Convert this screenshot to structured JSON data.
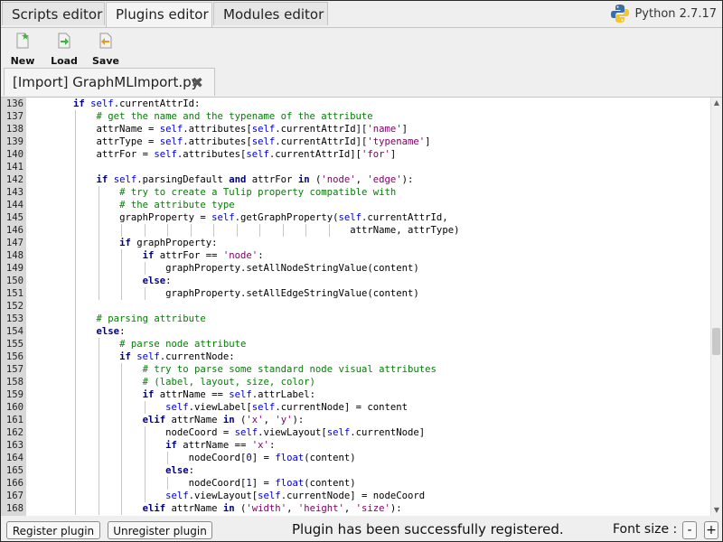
{
  "tabs": [
    {
      "label": "Scripts editor",
      "active": false
    },
    {
      "label": "Plugins editor",
      "active": true
    },
    {
      "label": "Modules editor",
      "active": false
    }
  ],
  "python_version": "Python 2.7.17",
  "toolbar": {
    "new_label": "New",
    "load_label": "Load",
    "save_label": "Save"
  },
  "file_tab": {
    "label": "[Import] GraphMLImport.py",
    "close_glyph": "✖"
  },
  "code_lines": [
    {
      "n": "136",
      "indent": 2,
      "guides": 2,
      "tokens": [
        [
          "kw",
          "if "
        ],
        [
          "sf",
          "self"
        ],
        [
          "",
          "."
        ],
        [
          "",
          "currentAttrId:"
        ]
      ]
    },
    {
      "n": "137",
      "indent": 3,
      "guides": 3,
      "tokens": [
        [
          "cm",
          "# get the name and the typename of the attribute"
        ]
      ]
    },
    {
      "n": "138",
      "indent": 3,
      "guides": 3,
      "tokens": [
        [
          "",
          "attrName = "
        ],
        [
          "sf",
          "self"
        ],
        [
          "",
          ".attributes["
        ],
        [
          "sf",
          "self"
        ],
        [
          "",
          ".currentAttrId]["
        ],
        [
          "st",
          "'name'"
        ],
        [
          "",
          "]"
        ]
      ]
    },
    {
      "n": "139",
      "indent": 3,
      "guides": 3,
      "tokens": [
        [
          "",
          "attrType = "
        ],
        [
          "sf",
          "self"
        ],
        [
          "",
          ".attributes["
        ],
        [
          "sf",
          "self"
        ],
        [
          "",
          ".currentAttrId]["
        ],
        [
          "st",
          "'typename'"
        ],
        [
          "",
          "]"
        ]
      ]
    },
    {
      "n": "140",
      "indent": 3,
      "guides": 3,
      "tokens": [
        [
          "",
          "attrFor = "
        ],
        [
          "sf",
          "self"
        ],
        [
          "",
          ".attributes["
        ],
        [
          "sf",
          "self"
        ],
        [
          "",
          ".currentAttrId]["
        ],
        [
          "st",
          "'for'"
        ],
        [
          "",
          "]"
        ]
      ]
    },
    {
      "n": "141",
      "indent": 0,
      "guides": 3,
      "tokens": []
    },
    {
      "n": "142",
      "indent": 3,
      "guides": 3,
      "tokens": [
        [
          "kw",
          "if "
        ],
        [
          "sf",
          "self"
        ],
        [
          "",
          ".parsingDefault "
        ],
        [
          "kw",
          "and"
        ],
        [
          "",
          " attrFor "
        ],
        [
          "kw",
          "in"
        ],
        [
          "",
          " ("
        ],
        [
          "st",
          "'node'"
        ],
        [
          "",
          ", "
        ],
        [
          "st",
          "'edge'"
        ],
        [
          "",
          "):"
        ]
      ]
    },
    {
      "n": "143",
      "indent": 4,
      "guides": 4,
      "tokens": [
        [
          "cm",
          "# try to create a Tulip property compatible with"
        ]
      ]
    },
    {
      "n": "144",
      "indent": 4,
      "guides": 4,
      "tokens": [
        [
          "cm",
          "# the attribute type"
        ]
      ]
    },
    {
      "n": "145",
      "indent": 4,
      "guides": 4,
      "tokens": [
        [
          "",
          "graphProperty = "
        ],
        [
          "sf",
          "self"
        ],
        [
          "",
          ".getGraphProperty("
        ],
        [
          "sf",
          "self"
        ],
        [
          "",
          ".currentAttrId,"
        ]
      ]
    },
    {
      "n": "146",
      "indent": 14,
      "guides": 14,
      "tokens": [
        [
          "",
          "attrName, attrType)"
        ]
      ]
    },
    {
      "n": "147",
      "indent": 4,
      "guides": 4,
      "tokens": [
        [
          "kw",
          "if "
        ],
        [
          "",
          "graphProperty:"
        ]
      ]
    },
    {
      "n": "148",
      "indent": 5,
      "guides": 5,
      "tokens": [
        [
          "kw",
          "if "
        ],
        [
          "",
          "attrFor == "
        ],
        [
          "st",
          "'node'"
        ],
        [
          "",
          ":"
        ]
      ]
    },
    {
      "n": "149",
      "indent": 6,
      "guides": 6,
      "tokens": [
        [
          "",
          "graphProperty.setAllNodeStringValue(content)"
        ]
      ]
    },
    {
      "n": "150",
      "indent": 5,
      "guides": 5,
      "tokens": [
        [
          "kw",
          "else"
        ],
        [
          "",
          ":"
        ]
      ]
    },
    {
      "n": "151",
      "indent": 6,
      "guides": 6,
      "tokens": [
        [
          "",
          "graphProperty.setAllEdgeStringValue(content)"
        ]
      ]
    },
    {
      "n": "152",
      "indent": 0,
      "guides": 3,
      "tokens": []
    },
    {
      "n": "153",
      "indent": 3,
      "guides": 3,
      "tokens": [
        [
          "cm",
          "# parsing attribute"
        ]
      ]
    },
    {
      "n": "154",
      "indent": 3,
      "guides": 3,
      "tokens": [
        [
          "kw",
          "else"
        ],
        [
          "",
          ":"
        ]
      ]
    },
    {
      "n": "155",
      "indent": 4,
      "guides": 4,
      "tokens": [
        [
          "cm",
          "# parse node attribute"
        ]
      ]
    },
    {
      "n": "156",
      "indent": 4,
      "guides": 4,
      "tokens": [
        [
          "kw",
          "if "
        ],
        [
          "sf",
          "self"
        ],
        [
          "",
          ".currentNode:"
        ]
      ]
    },
    {
      "n": "157",
      "indent": 5,
      "guides": 5,
      "tokens": [
        [
          "cm",
          "# try to parse some standard node visual attributes"
        ]
      ]
    },
    {
      "n": "158",
      "indent": 5,
      "guides": 5,
      "tokens": [
        [
          "cm",
          "# (label, layout, size, color)"
        ]
      ]
    },
    {
      "n": "159",
      "indent": 5,
      "guides": 5,
      "tokens": [
        [
          "kw",
          "if "
        ],
        [
          "",
          "attrName == "
        ],
        [
          "sf",
          "self"
        ],
        [
          "",
          ".attrLabel:"
        ]
      ]
    },
    {
      "n": "160",
      "indent": 6,
      "guides": 6,
      "tokens": [
        [
          "sf",
          "self"
        ],
        [
          "",
          ".viewLabel["
        ],
        [
          "sf",
          "self"
        ],
        [
          "",
          ".currentNode] = content"
        ]
      ]
    },
    {
      "n": "161",
      "indent": 5,
      "guides": 5,
      "tokens": [
        [
          "kw",
          "elif "
        ],
        [
          "",
          "attrName "
        ],
        [
          "kw",
          "in"
        ],
        [
          "",
          " ("
        ],
        [
          "st",
          "'x'"
        ],
        [
          "",
          ", "
        ],
        [
          "st",
          "'y'"
        ],
        [
          "",
          "):"
        ]
      ]
    },
    {
      "n": "162",
      "indent": 6,
      "guides": 6,
      "tokens": [
        [
          "",
          "nodeCoord = "
        ],
        [
          "sf",
          "self"
        ],
        [
          "",
          ".viewLayout["
        ],
        [
          "sf",
          "self"
        ],
        [
          "",
          ".currentNode]"
        ]
      ]
    },
    {
      "n": "163",
      "indent": 6,
      "guides": 6,
      "tokens": [
        [
          "kw",
          "if "
        ],
        [
          "",
          "attrName == "
        ],
        [
          "st",
          "'x'"
        ],
        [
          "",
          ":"
        ]
      ]
    },
    {
      "n": "164",
      "indent": 7,
      "guides": 7,
      "tokens": [
        [
          "",
          "nodeCoord["
        ],
        [
          "bi",
          "0"
        ],
        [
          "",
          "] = "
        ],
        [
          "sf",
          "float"
        ],
        [
          "",
          "(content)"
        ]
      ]
    },
    {
      "n": "165",
      "indent": 6,
      "guides": 6,
      "tokens": [
        [
          "kw",
          "else"
        ],
        [
          "",
          ":"
        ]
      ]
    },
    {
      "n": "166",
      "indent": 7,
      "guides": 7,
      "tokens": [
        [
          "",
          "nodeCoord["
        ],
        [
          "bi",
          "1"
        ],
        [
          "",
          "] = "
        ],
        [
          "sf",
          "float"
        ],
        [
          "",
          "(content)"
        ]
      ]
    },
    {
      "n": "167",
      "indent": 6,
      "guides": 6,
      "tokens": [
        [
          "sf",
          "self"
        ],
        [
          "",
          ".viewLayout["
        ],
        [
          "sf",
          "self"
        ],
        [
          "",
          ".currentNode] = nodeCoord"
        ]
      ]
    },
    {
      "n": "168",
      "indent": 5,
      "guides": 5,
      "tokens": [
        [
          "kw",
          "elif "
        ],
        [
          "",
          "attrName "
        ],
        [
          "kw",
          "in"
        ],
        [
          "",
          " ("
        ],
        [
          "st",
          "'width'"
        ],
        [
          "",
          ", "
        ],
        [
          "st",
          "'height'"
        ],
        [
          "",
          ", "
        ],
        [
          "st",
          "'size'"
        ],
        [
          "",
          "):"
        ]
      ]
    }
  ],
  "statusbar": {
    "register_label": "Register plugin",
    "unregister_label": "Unregister plugin",
    "message": "Plugin has been successfully registered.",
    "font_size_label": "Font size :",
    "minus_label": "-",
    "plus_label": "+"
  }
}
